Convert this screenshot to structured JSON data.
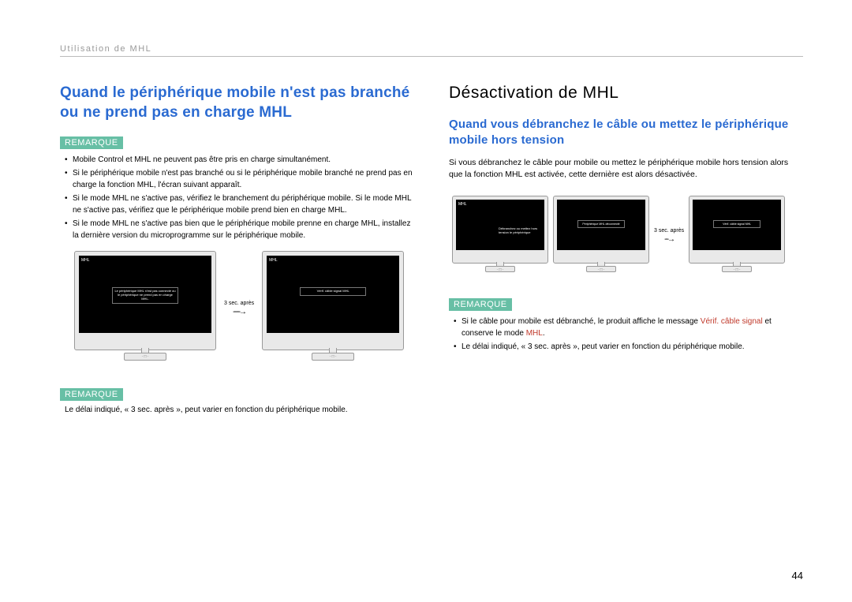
{
  "header": {
    "breadcrumb": "Utilisation de MHL"
  },
  "left": {
    "h1": "Quand le périphérique mobile n'est pas branché ou ne prend pas en charge MHL",
    "remarque": "REMARQUE",
    "bullets": [
      "Mobile Control et MHL ne peuvent pas être pris en charge simultanément.",
      "Si le périphérique mobile n'est pas branché ou si le périphérique mobile branché ne prend pas en charge la fonction MHL, l'écran suivant apparaît.",
      "Si le mode MHL ne s'active pas, vérifiez le branchement du périphérique mobile. Si le mode MHL ne s'active pas, vérifiez que le périphérique mobile prend bien en charge MHL.",
      "Si le mode MHL ne s'active pas bien que le périphérique mobile prenne en charge MHL, installez la dernière version du microprogramme sur le périphérique mobile."
    ],
    "fig": {
      "transition": "3 sec. après",
      "mon1": {
        "tag": "MHL",
        "box": "Le périphérique MHL n'est pas connecté ou le périphérique ne prend pas en charge MHL."
      },
      "mon2": {
        "tag": "MHL",
        "box": "Vérif. câble signal\nMHL"
      }
    },
    "remarque2": "REMARQUE",
    "note2": "Le délai indiqué, « 3 sec. après », peut varier en fonction du périphérique mobile."
  },
  "right": {
    "h1": "Désactivation de MHL",
    "h2": "Quand vous débranchez le câble ou mettez le périphérique mobile hors tension",
    "para": "Si vous débranchez le câble pour mobile ou mettez le périphérique mobile hors tension alors que la fonction MHL est activée, cette dernière est alors désactivée.",
    "fig": {
      "transition": "3 sec. après",
      "mon1": {
        "tag": "MHL",
        "caption": "Débranchez ou mettez hors tension le périphérique"
      },
      "mon2": {
        "box": "Périphérique MHL déconnecté"
      },
      "mon3": {
        "box": "Vérif. câble signal\nMHL"
      }
    },
    "remarque": "REMARQUE",
    "bullets": [
      {
        "pre": "Si le câble pour mobile est débranché, le produit affiche le message ",
        "red1": "Vérif. câble signal",
        "mid": " et conserve le mode ",
        "red2": "MHL",
        "post": "."
      },
      {
        "text": "Le délai indiqué, « 3 sec. après », peut varier en fonction du périphérique mobile."
      }
    ]
  },
  "pagenum": "44"
}
